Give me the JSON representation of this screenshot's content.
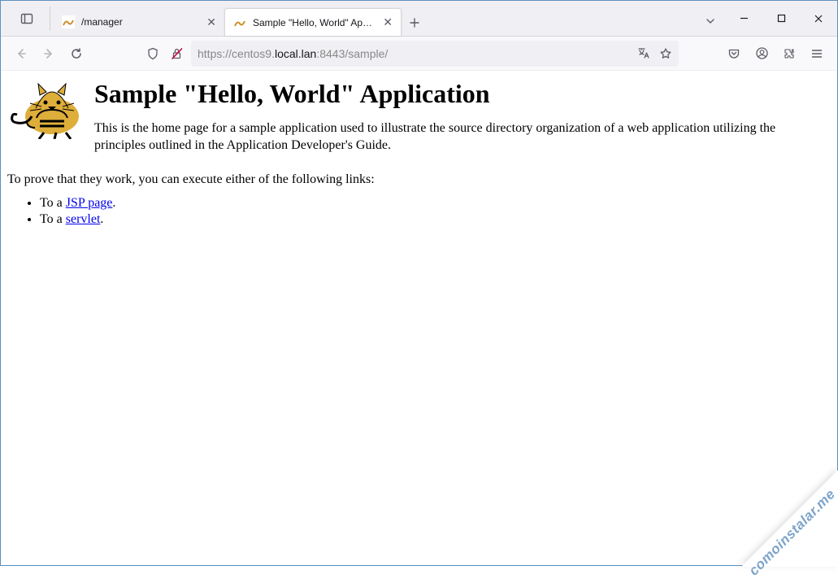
{
  "tabs": [
    {
      "label": "/manager"
    },
    {
      "label": "Sample \"Hello, World\" Applicati"
    }
  ],
  "url": {
    "scheme": "https://",
    "dim_prefix": "centos9.",
    "dark": "local.lan",
    "dim_suffix": ":8443/sample/"
  },
  "page": {
    "title": "Sample \"Hello, World\" Application",
    "intro": "This is the home page for a sample application used to illustrate the source directory organization of a web application utilizing the principles outlined in the Application Developer's Guide.",
    "prove": "To prove that they work, you can execute either of the following links:",
    "li1_prefix": "To a ",
    "li1_link": "JSP page",
    "li1_suffix": ".",
    "li2_prefix": "To a ",
    "li2_link": "servlet",
    "li2_suffix": "."
  },
  "watermark": "comoinstalar.me"
}
